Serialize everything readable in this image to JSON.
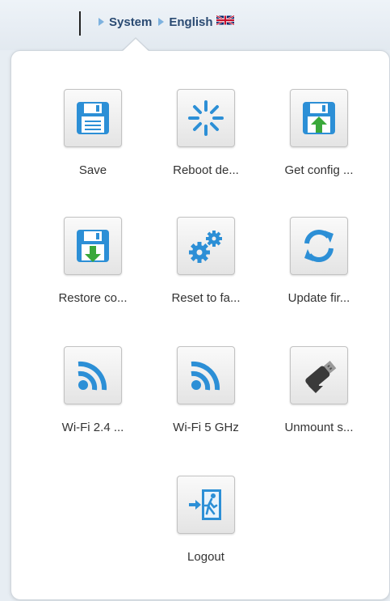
{
  "breadcrumb": {
    "system": "System",
    "language": "English"
  },
  "menu": {
    "items": [
      {
        "label": "Save",
        "icon": "floppy-save-icon"
      },
      {
        "label": "Reboot de...",
        "icon": "reboot-icon"
      },
      {
        "label": "Get config ...",
        "icon": "floppy-upload-icon"
      },
      {
        "label": "Restore co...",
        "icon": "floppy-download-icon"
      },
      {
        "label": "Reset to fa...",
        "icon": "gears-icon"
      },
      {
        "label": "Update fir...",
        "icon": "refresh-icon"
      },
      {
        "label": "Wi-Fi 2.4 ...",
        "icon": "wifi-icon"
      },
      {
        "label": "Wi-Fi 5 GHz",
        "icon": "wifi-icon"
      },
      {
        "label": "Unmount s...",
        "icon": "usb-unmount-icon"
      },
      {
        "label": "Logout",
        "icon": "exit-icon"
      }
    ]
  },
  "colors": {
    "icon_blue": "#2c8fd6",
    "icon_green": "#3aa83a",
    "icon_dark": "#3a3a3a"
  }
}
